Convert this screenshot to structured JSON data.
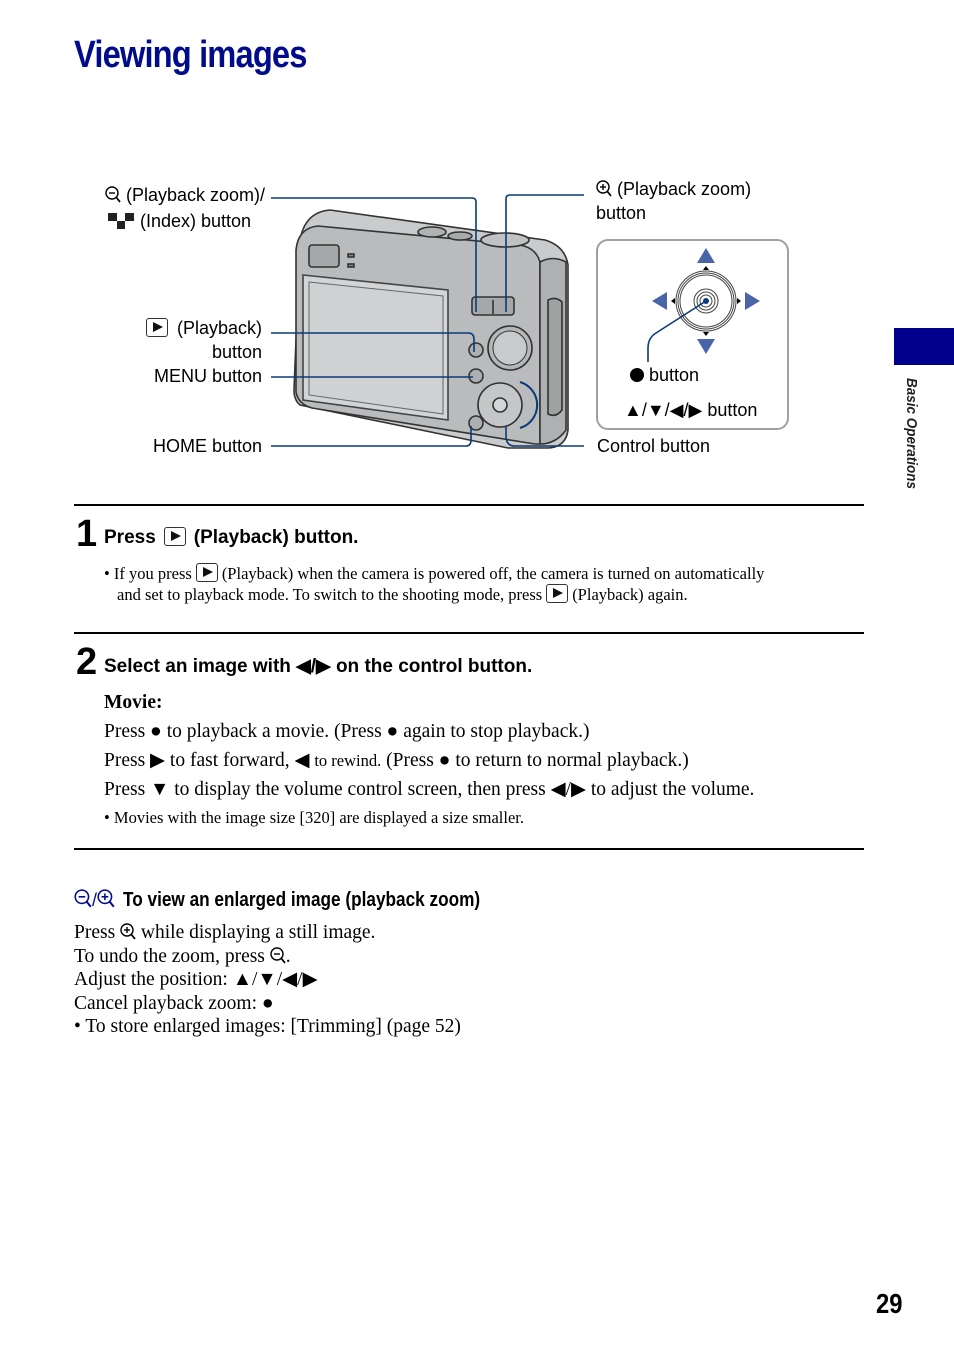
{
  "page": {
    "title": "Viewing images",
    "section_tab": "Basic Operations",
    "page_number": "29",
    "accent_color": "#000c8c"
  },
  "diagram": {
    "labels": {
      "zoom_out_index_line1": "(Playback zoom)/",
      "zoom_out_index_line2": "(Index) button",
      "playback_line1": "(Playback)",
      "playback_line2": "button",
      "menu": "MENU button",
      "home": "HOME button",
      "zoom_in_line1": "(Playback zoom)",
      "zoom_in_line2": "button",
      "center_button": "button",
      "direction_buttons": "▲/▼/◀/▶ button",
      "control_button": "Control button"
    },
    "icons": [
      "zoom-out-icon",
      "index-icon",
      "playback-icon",
      "zoom-in-icon",
      "center-dot-icon"
    ],
    "leader_color": "#0a3a7a",
    "arrow_color": "#4a64a8"
  },
  "step1": {
    "number": "1",
    "heading_pre": "Press",
    "heading_post": "(Playback) button.",
    "bullet_a_pre": "If you press",
    "bullet_a_post": "(Playback) when the camera is powered off, the camera is turned on automatically",
    "bullet_b_pre": "and set to playback mode. To switch to the shooting mode, press",
    "bullet_b_post": "(Playback) again."
  },
  "step2": {
    "number": "2",
    "heading": "Select an image with ◀/▶ on the control button.",
    "movie_label": "Movie:",
    "line1": "Press ● to playback a movie. (Press ● again to stop playback.)",
    "line2_a": "Press ▶ to fast forward, ◀",
    "line2_b": "to rewind.",
    "line2_c": "(Press ● to return to normal playback.)",
    "line3": "Press ▼ to display the volume control screen, then press ◀/▶ to adjust the volume.",
    "note": "Movies with the image size [320] are displayed a size smaller."
  },
  "zoom_section": {
    "heading": "To view an enlarged image (playback zoom)",
    "line1_pre": "Press",
    "line1_post": "while displaying a still image.",
    "line2_pre": "To undo the zoom, press",
    "line2_post": ".",
    "line3": "Adjust the position: ▲/▼/◀/▶",
    "line4": "Cancel playback zoom: ●",
    "bullet": "To store enlarged images: [Trimming] (page 52)"
  }
}
